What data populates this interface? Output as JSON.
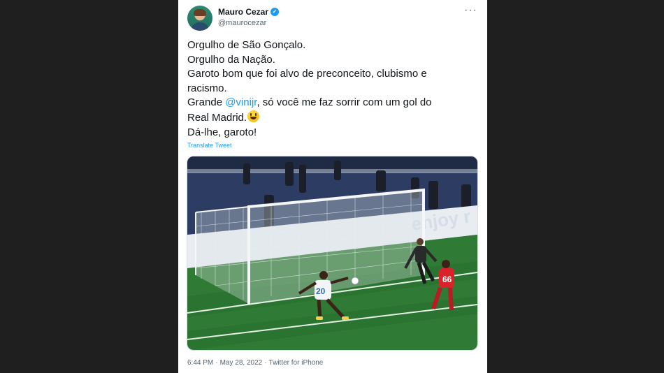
{
  "tweet": {
    "display_name": "Mauro Cezar",
    "handle": "@maurocezar",
    "more_label": "···",
    "text": {
      "line1": "Orgulho de São Gonçalo.",
      "line2": "Orgulho da Nação.",
      "line3": "Garoto bom que foi alvo de preconceito, clubismo e",
      "line4": "racismo.",
      "line5_pre": "Grande ",
      "mention": "@vinijr",
      "line5_post": ", só você me faz sorrir com um gol do",
      "line6": "Real Madrid.",
      "line7": "Dá-lhe, garoto!"
    },
    "translate_label": "Translate Tweet",
    "photo": {
      "banner_text": "enjoy r",
      "player_white_number": "20",
      "player_red_number": "66"
    },
    "meta": {
      "time": "6:44 PM",
      "sep1": "·",
      "date": "May 28, 2022",
      "sep2": "·",
      "source": "Twitter for iPhone"
    }
  },
  "colors": {
    "accent": "#1d9bf0",
    "background": "#1f1f1f",
    "pitch": "#2f7a34"
  }
}
